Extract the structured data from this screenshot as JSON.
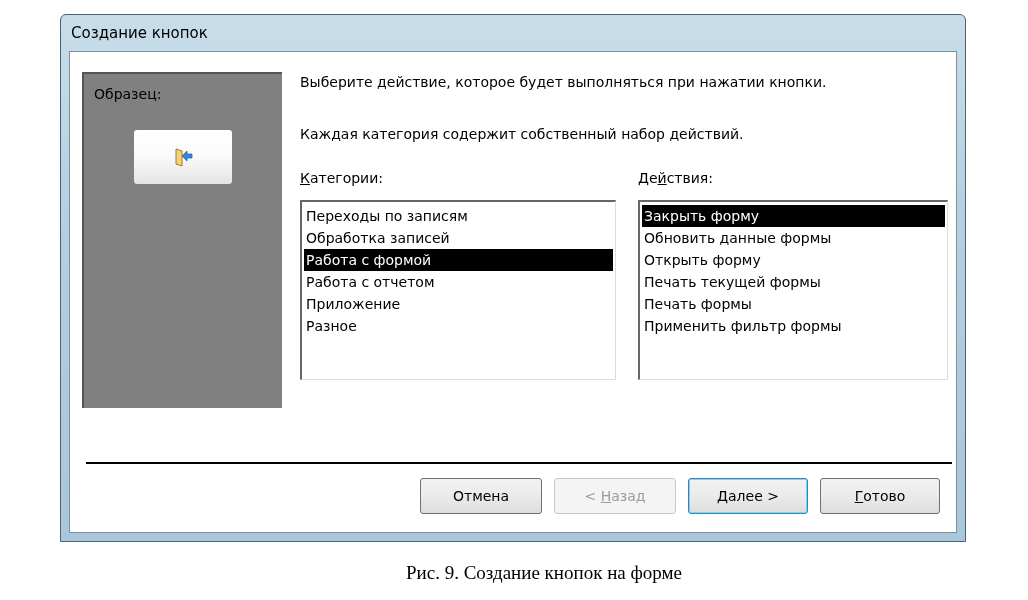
{
  "window": {
    "title": "Создание кнопок"
  },
  "sample": {
    "label": "Образец:"
  },
  "instructions": [
    "Выберите действие, которое будет выполняться при нажатии кнопки.",
    "Каждая категория содержит собственный набор действий."
  ],
  "categories": {
    "label_parts": {
      "key": "К",
      "after": "атегории:"
    },
    "items": [
      {
        "label": "Переходы по записям",
        "selected": false
      },
      {
        "label": "Обработка записей",
        "selected": false
      },
      {
        "label": "Работа с формой",
        "selected": true
      },
      {
        "label": "Работа с отчетом",
        "selected": false
      },
      {
        "label": "Приложение",
        "selected": false
      },
      {
        "label": "Разное",
        "selected": false
      }
    ]
  },
  "actions": {
    "label_parts": {
      "before": "Де",
      "key": "й",
      "after": "ствия:"
    },
    "items": [
      {
        "label": "Закрыть форму",
        "selected": true
      },
      {
        "label": "Обновить данные формы",
        "selected": false
      },
      {
        "label": "Открыть форму",
        "selected": false
      },
      {
        "label": "Печать текущей формы",
        "selected": false
      },
      {
        "label": "Печать формы",
        "selected": false
      },
      {
        "label": "Применить фильтр формы",
        "selected": false
      }
    ]
  },
  "buttons": [
    {
      "label_parts": {
        "before": "Отмена"
      },
      "disabled": false,
      "default": false
    },
    {
      "label_parts": {
        "before": "< ",
        "key": "Н",
        "after": "азад"
      },
      "disabled": true,
      "default": false
    },
    {
      "label_parts": {
        "key": "Д",
        "after": "алее >"
      },
      "disabled": false,
      "default": true
    },
    {
      "label_parts": {
        "key": "Г",
        "after": "отово"
      },
      "disabled": false,
      "default": false
    }
  ],
  "caption": "Рис. 9. Создание кнопок на форме"
}
